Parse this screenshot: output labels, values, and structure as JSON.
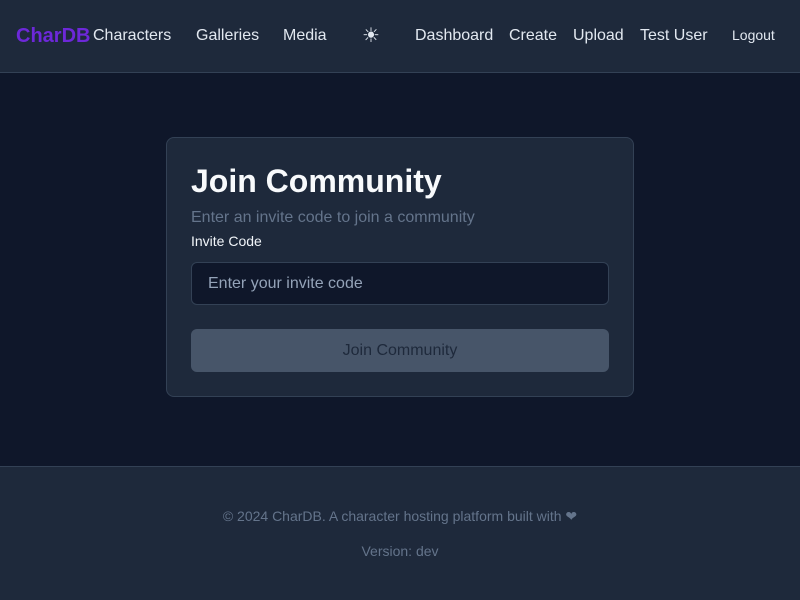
{
  "nav": {
    "brand": "CharDB",
    "items": [
      {
        "label": "Characters"
      },
      {
        "label": "Galleries"
      },
      {
        "label": "Media"
      }
    ],
    "theme_toggle_icon": "☀",
    "theme_toggle_icon_name": "sun-icon",
    "right_items": [
      {
        "label": "Dashboard"
      },
      {
        "label": "Create"
      },
      {
        "label": "Upload"
      },
      {
        "label": "Test User"
      }
    ],
    "logout_label": "Logout"
  },
  "card": {
    "title": "Join Community",
    "subtitle": "Enter an invite code to join a community",
    "field_label": "Invite Code",
    "input_placeholder": "Enter your invite code",
    "input_value": "",
    "button_label": "Join Community"
  },
  "footer": {
    "copyright": "© 2024 CharDB. A character hosting platform built with ❤",
    "version": "Version: dev"
  },
  "colors": {
    "background": "#0f172a",
    "surface": "#1e293b",
    "brand": "#6d28d9",
    "button": "#475569",
    "muted_text": "#64748b"
  }
}
